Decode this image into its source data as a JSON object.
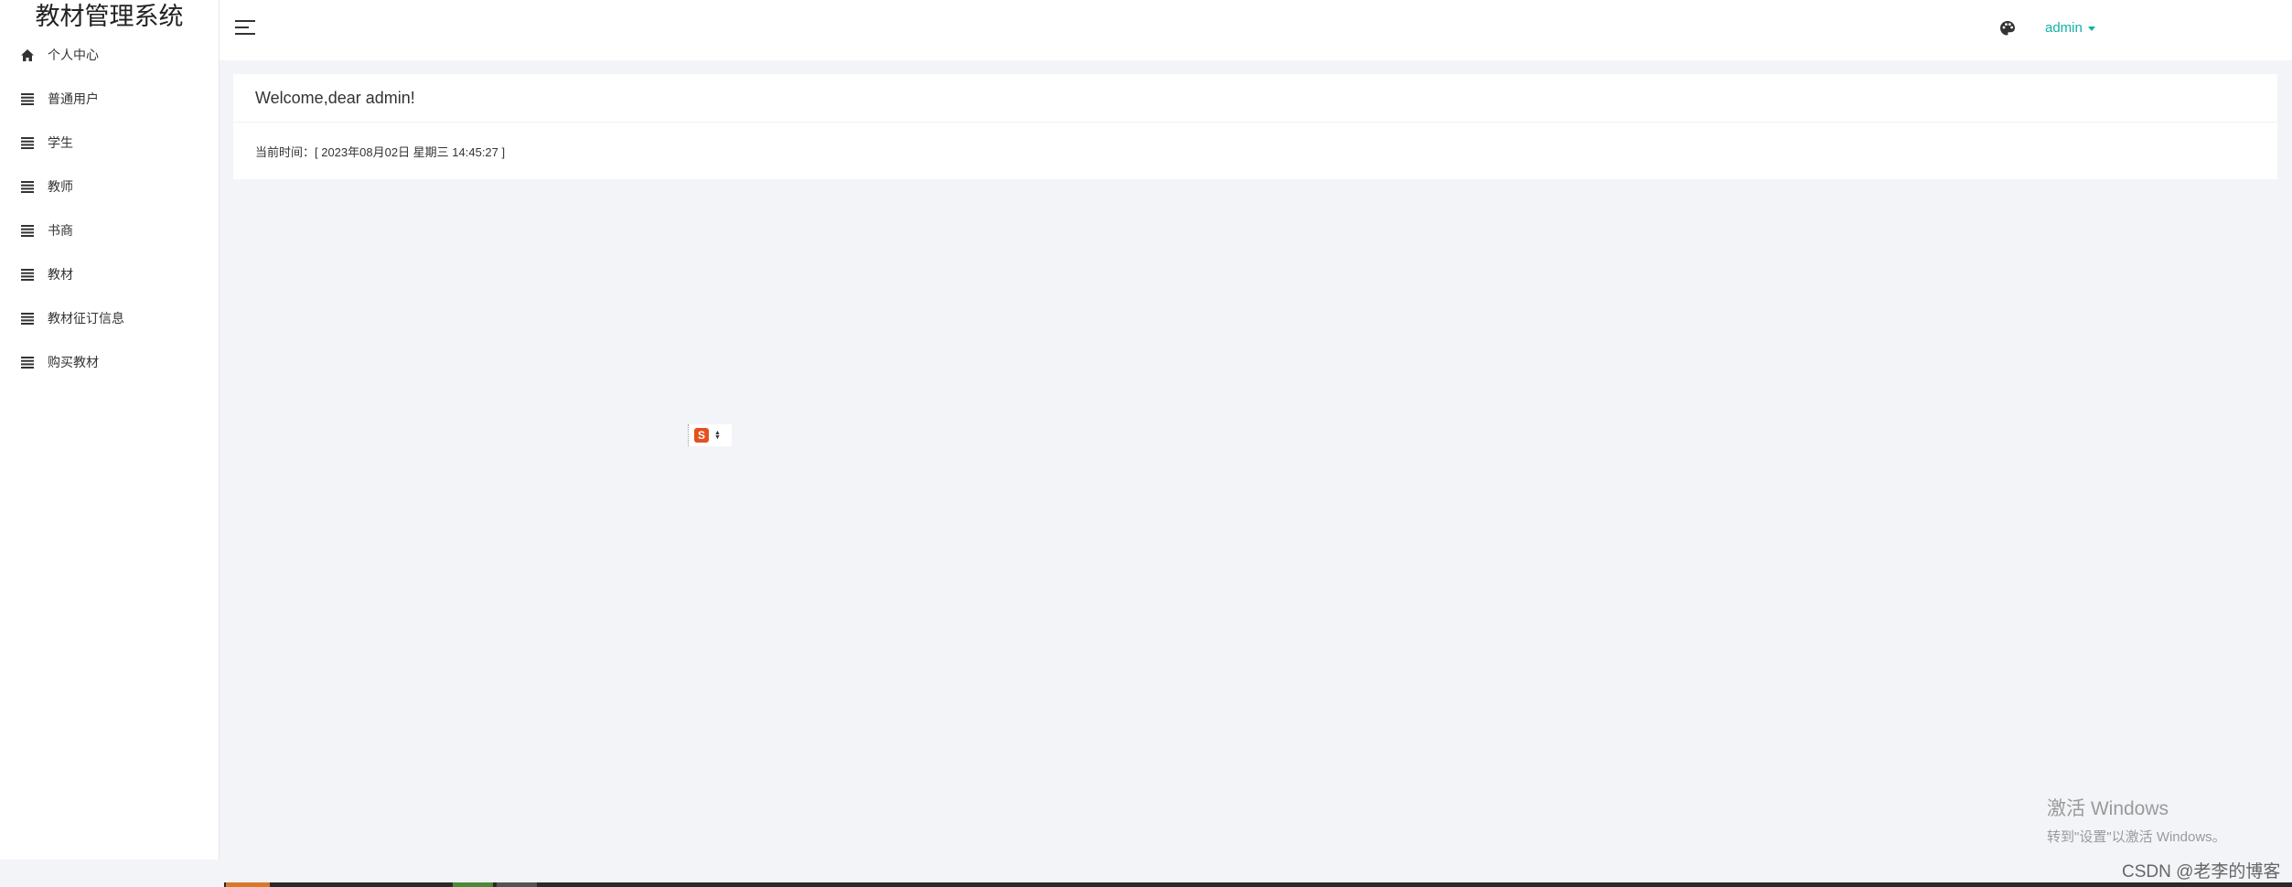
{
  "sidebar": {
    "brand": "教材管理系统",
    "items": [
      {
        "label": "个人中心",
        "icon": "home-icon"
      },
      {
        "label": "普通用户",
        "icon": "list-icon"
      },
      {
        "label": "学生",
        "icon": "list-icon"
      },
      {
        "label": "教师",
        "icon": "list-icon"
      },
      {
        "label": "书商",
        "icon": "list-icon"
      },
      {
        "label": "教材",
        "icon": "list-icon"
      },
      {
        "label": "教材征订信息",
        "icon": "list-icon"
      },
      {
        "label": "购买教材",
        "icon": "list-icon"
      }
    ]
  },
  "header": {
    "user": "admin",
    "icons": [
      "menu-toggle-icon",
      "palette-icon",
      "caret-down-icon"
    ]
  },
  "main": {
    "welcome": "Welcome,dear admin!",
    "time_text": "当前时间：[ 2023年08月02日 星期三 14:45:27 ]"
  },
  "ime": {
    "logo": "S"
  },
  "overlay": {
    "activate_title": "激活 Windows",
    "activate_sub": "转到\"设置\"以激活 Windows。",
    "watermark": "CSDN @老李的博客"
  },
  "colors": {
    "accent": "#12b0a6",
    "background": "#f3f4f8",
    "ime_brand": "#e5501d"
  }
}
